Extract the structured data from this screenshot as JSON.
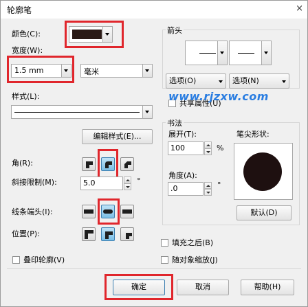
{
  "dialog": {
    "title": "轮廓笔",
    "close_glyph": "×"
  },
  "left": {
    "color_label": "颜色(C):",
    "color_value": "#2a1a16",
    "width_label": "宽度(W):",
    "width_value": "1.5 mm",
    "unit_value": "毫米",
    "style_label": "样式(L):",
    "edit_style_button": "编辑样式(E)...",
    "corner_label": "角(R):",
    "miter_label": "斜接限制(M):",
    "miter_value": "5.0",
    "miter_unit": "°",
    "linecap_label": "线条端头(I):",
    "position_label": "位置(P):",
    "print_behind_label": "叠印轮廓(V)"
  },
  "right": {
    "arrows_group": "箭头",
    "options_left": "选项(O)",
    "options_right": "选项(N)",
    "share_attributes": "共享属性(U)",
    "calligraphy_group": "书法",
    "stretch_label": "展开(T):",
    "stretch_value": "100",
    "stretch_unit": "%",
    "angle_label": "角度(A):",
    "angle_value": ".0",
    "angle_unit": "°",
    "nib_shape_label": "笔尖形状:",
    "default_button": "默认(D)",
    "behind_fill_label": "填充之后(B)",
    "scale_with_image_label": "随对象缩放(J)"
  },
  "footer": {
    "ok": "确定",
    "cancel": "取消",
    "help": "帮助(H)"
  },
  "watermark": "www.rjzxw.com",
  "colors": {
    "highlight": "#e0262c",
    "selected_button": "#7bbfe6",
    "nib": "#1e1010"
  }
}
